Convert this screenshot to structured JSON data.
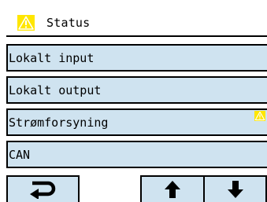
{
  "header": {
    "title": "Status",
    "icon": "warning-icon"
  },
  "menu": {
    "items": [
      {
        "label": "Lokalt input"
      },
      {
        "label": "Lokalt output"
      },
      {
        "label": "Strømforsyning",
        "warning": true
      },
      {
        "label": "CAN"
      }
    ]
  },
  "toolbar": {
    "back_icon": "return-icon",
    "up_icon": "arrow-up-icon",
    "down_icon": "arrow-down-icon"
  },
  "colors": {
    "item_bg": "#cfe3f0",
    "warning_yellow": "#ffe600",
    "border": "#000000"
  }
}
